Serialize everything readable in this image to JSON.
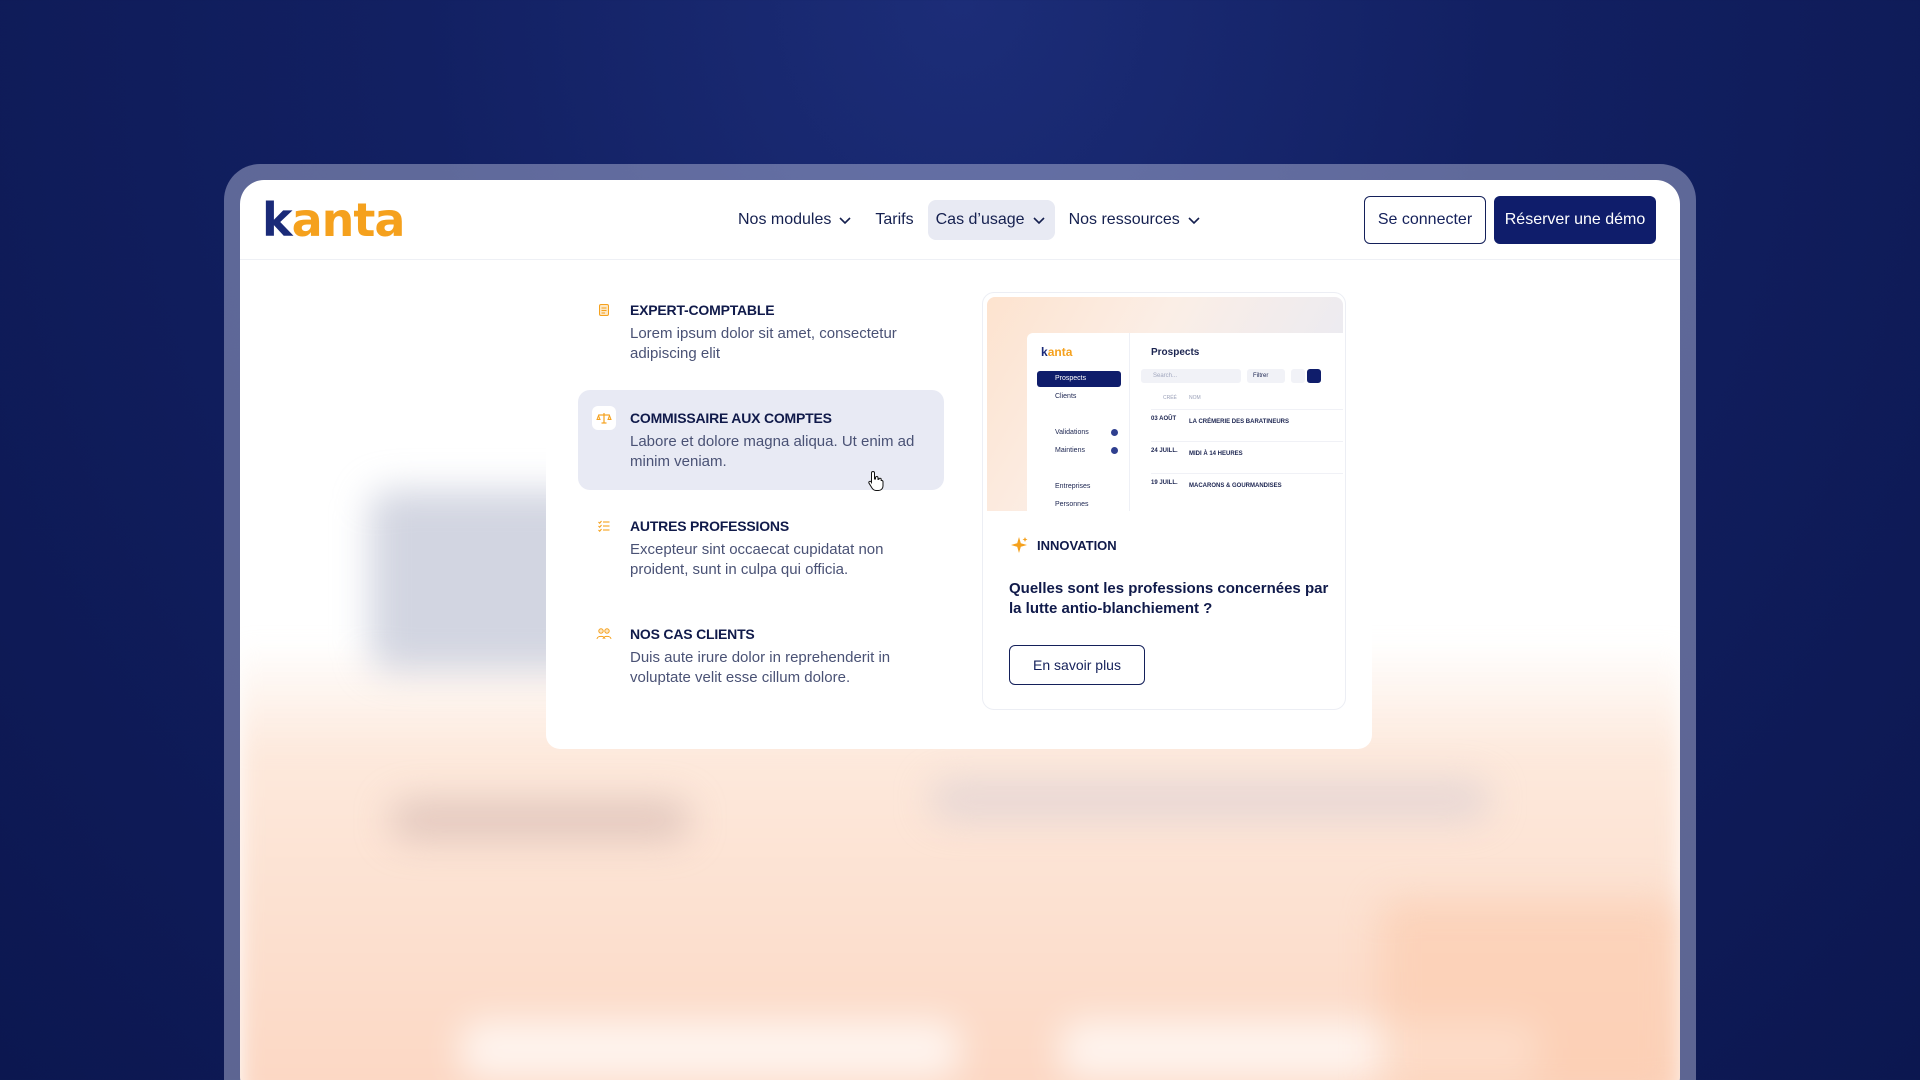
{
  "brand": {
    "logo_prefix": "k",
    "logo_rest": "anta",
    "accent_color": "#f5a11d",
    "primary_color": "#0f1d6b"
  },
  "nav": {
    "links": [
      {
        "label": "Nos modules",
        "has_dropdown": true
      },
      {
        "label": "Tarifs",
        "has_dropdown": false
      },
      {
        "label": "Cas d’usage",
        "has_dropdown": true,
        "active": true
      },
      {
        "label": "Nos ressources",
        "has_dropdown": true
      }
    ],
    "login_label": "Se connecter",
    "demo_label": "Réserver une démo"
  },
  "dropdown": {
    "items": [
      {
        "icon": "document-icon",
        "title": "EXPERT-COMPTABLE",
        "desc": "Lorem ipsum dolor sit amet, consectetur adipiscing elit"
      },
      {
        "icon": "scale-icon",
        "title": "COMMISSAIRE AUX COMPTES",
        "desc": "Labore et dolore magna aliqua. Ut enim ad minim veniam."
      },
      {
        "icon": "checklist-icon",
        "title": "AUTRES PROFESSIONS",
        "desc": "Excepteur sint occaecat cupidatat non proident, sunt in culpa qui officia."
      },
      {
        "icon": "users-icon",
        "title": "NOS CAS CLIENTS",
        "desc": "Duis aute irure dolor in reprehenderit in voluptate velit esse cillum dolore."
      }
    ],
    "card": {
      "tag": "INNOVATION",
      "title": "Quelles sont les professions concernées par la lutte antio-blanchiement ?",
      "button": "En savoir plus",
      "mock": {
        "logo_prefix": "k",
        "logo_rest": "anta",
        "page_title": "Prospects",
        "sidebar": [
          "Prospects",
          "Clients",
          "Validations",
          "Maintiens",
          "Entreprises",
          "Personnes"
        ],
        "search_placeholder": "Search...",
        "filter": "Filtrer",
        "col_date": "CRÉÉ",
        "col_name": "NOM",
        "rows": [
          {
            "date": "03 AOÛT",
            "name": "LA CRÉMERIE DES BARATINEURS"
          },
          {
            "date": "24 JUILL.",
            "name": "MIDI À 14 HEURES"
          },
          {
            "date": "19 JUILL.",
            "name": "MACARONS & GOURMANDISES"
          }
        ]
      }
    }
  }
}
